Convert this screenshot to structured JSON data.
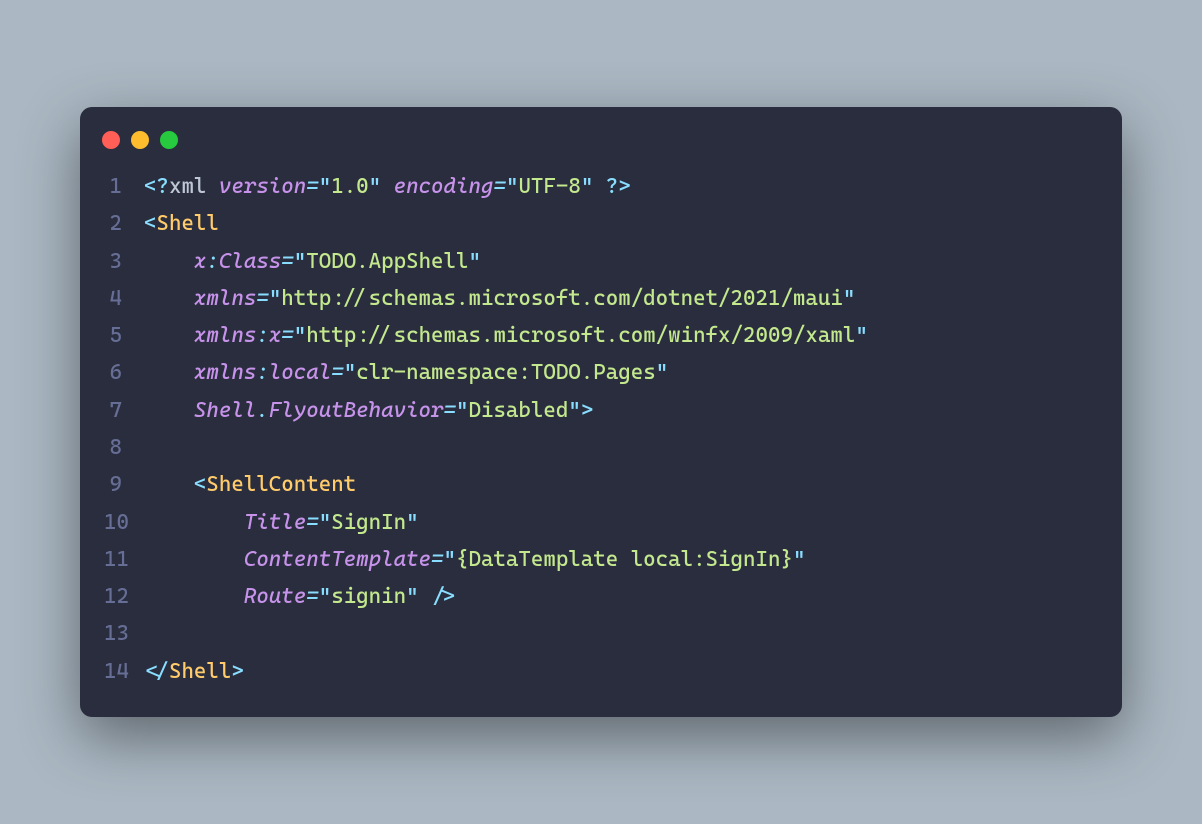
{
  "window": {
    "buttons": [
      "close",
      "minimize",
      "zoom"
    ]
  },
  "lines": {
    "l1": "1",
    "l2": "2",
    "l3": "3",
    "l4": "4",
    "l5": "5",
    "l6": "6",
    "l7": "7",
    "l8": "8",
    "l9": "9",
    "l10": "10",
    "l11": "11",
    "l12": "12",
    "l13": "13",
    "l14": "14"
  },
  "tok": {
    "lt": "<",
    "gt": ">",
    "sgt": "/>",
    "clt": "</",
    "qlt": "<?",
    "qgt": "?>",
    "eq": "=",
    "colon": ":",
    "dot": ".",
    "q": "\"",
    "xml": "xml",
    "version": "version",
    "encoding": "encoding",
    "v_version": "1.0",
    "v_encoding": "UTF-8",
    "Shell": "Shell",
    "x": "x",
    "Class": "Class",
    "v_class": "TODO.AppShell",
    "xmlns": "xmlns",
    "v_xmlns": "http://schemas.microsoft.com/dotnet/2021/maui",
    "v_xmlns_x": "http://schemas.microsoft.com/winfx/2009/xaml",
    "local": "local",
    "v_xmlns_local": "clr-namespace:TODO.Pages",
    "ShellAttr": "Shell",
    "FlyoutBehavior": "FlyoutBehavior",
    "v_flyout": "Disabled",
    "ShellContent": "ShellContent",
    "Title": "Title",
    "v_title": "SignIn",
    "ContentTemplate": "ContentTemplate",
    "v_template": "{DataTemplate local:SignIn}",
    "Route": "Route",
    "v_route": "signin"
  }
}
